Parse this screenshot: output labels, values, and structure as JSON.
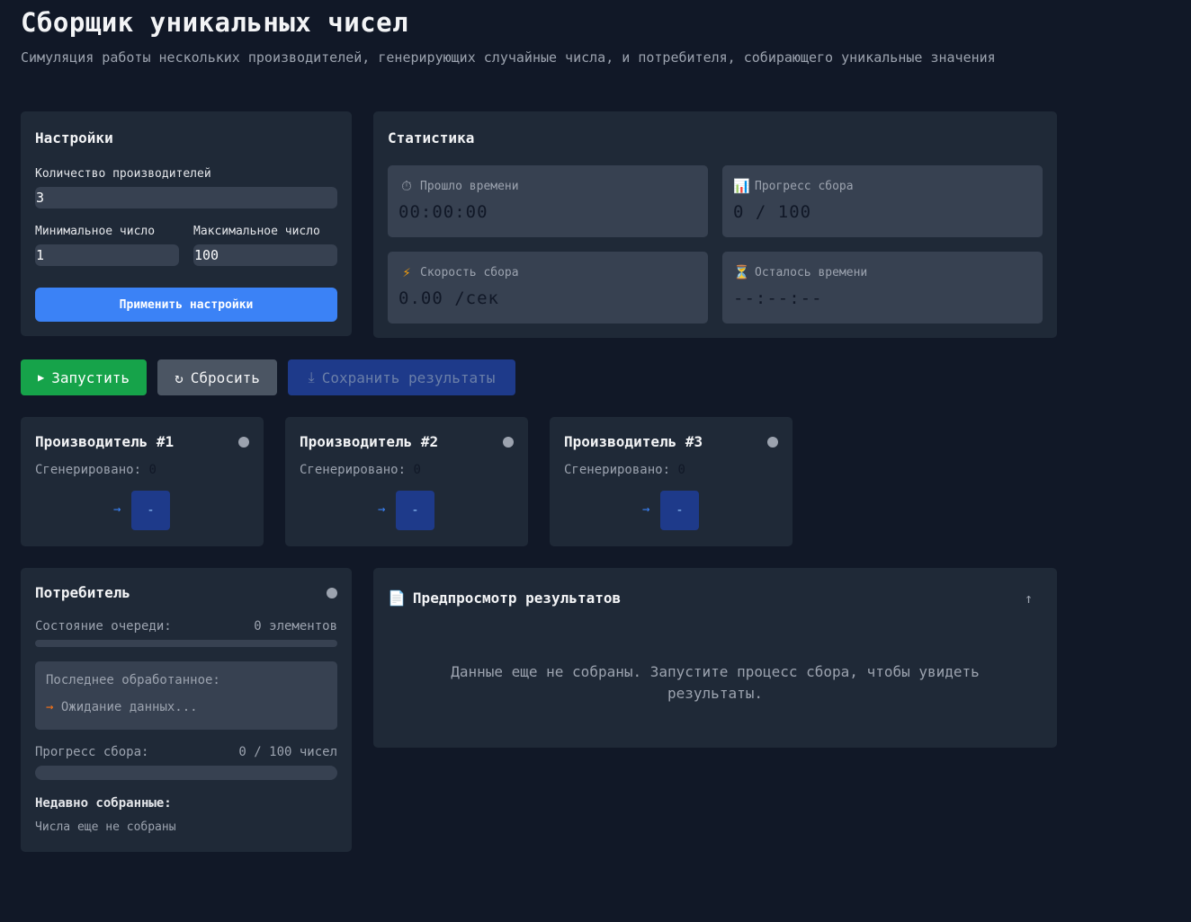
{
  "header": {
    "title": "Сборщик уникальных чисел",
    "subtitle": "Симуляция работы нескольких производителей, генерирующих случайные числа, и потребителя, собирающего уникальные значения"
  },
  "settings": {
    "title": "Настройки",
    "producers_label": "Количество производителей",
    "producers_value": "3",
    "min_label": "Минимальное число",
    "min_value": "1",
    "max_label": "Максимальное число",
    "max_value": "100",
    "apply_label": "Применить настройки"
  },
  "stats": {
    "title": "Статистика",
    "elapsed": {
      "icon": "stopwatch-icon",
      "label": "Прошло времени",
      "value": "00:00:00"
    },
    "progress": {
      "icon": "chart-icon",
      "label": "Прогресс сбора",
      "value": "0 / 100",
      "fraction": 0
    },
    "speed": {
      "icon": "lightning-icon",
      "label": "Скорость сбора",
      "value": "0.00 /сек"
    },
    "remaining": {
      "icon": "hourglass-icon",
      "label": "Осталось времени",
      "value": "--:--:--"
    }
  },
  "actions": {
    "start": {
      "icon": "play-icon",
      "label": "Запустить"
    },
    "reset": {
      "icon": "refresh-icon",
      "label": "Сбросить"
    },
    "save": {
      "icon": "download-icon",
      "label": "Сохранить результаты"
    }
  },
  "producers": [
    {
      "title": "Производитель #1",
      "generated_label": "Сгенерировано:",
      "generated_value": "0",
      "current": "-"
    },
    {
      "title": "Производитель #2",
      "generated_label": "Сгенерировано:",
      "generated_value": "0",
      "current": "-"
    },
    {
      "title": "Производитель #3",
      "generated_label": "Сгенерировано:",
      "generated_value": "0",
      "current": "-"
    }
  ],
  "consumer": {
    "title": "Потребитель",
    "queue_label": "Состояние очереди:",
    "queue_value": "0 элементов",
    "queue_fraction": 0,
    "last_label": "Последнее обработанное:",
    "last_value": "Ожидание данных...",
    "progress_label": "Прогресс сбора:",
    "progress_value": "0 / 100 чисел",
    "progress_fraction": 0,
    "recent_label": "Недавно собранные:",
    "recent_value": "Числа еще не собраны"
  },
  "preview": {
    "icon": "document-icon",
    "title": "Предпросмотр результатов",
    "empty_text": "Данные еще не собраны. Запустите процесс сбора, чтобы увидеть результаты."
  },
  "colors": {
    "background": "#111827",
    "card": "#1f2937",
    "accent": "#3b82f6",
    "start": "#16a34a",
    "reset": "#4b5563",
    "save": "#1e3a8a"
  }
}
